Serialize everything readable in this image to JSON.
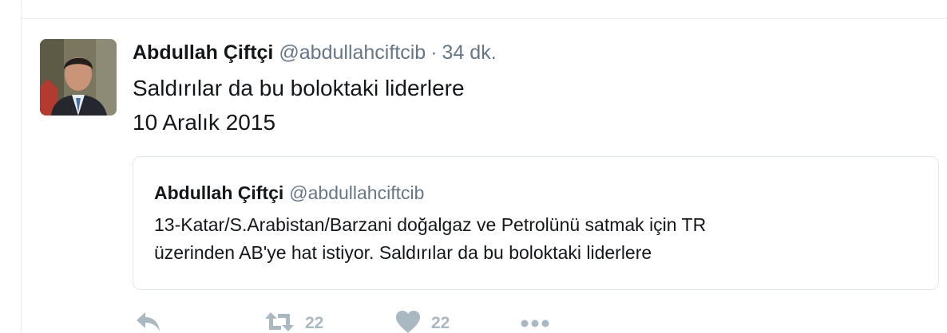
{
  "tweet": {
    "author_name": "Abdullah Çiftçi",
    "author_handle": "@abdullahciftcib",
    "separator": "·",
    "time": "34 dk.",
    "text_lines": [
      "Saldırılar da bu boloktaki liderlere",
      "10 Aralık 2015"
    ]
  },
  "quoted_tweet": {
    "author_name": "Abdullah Çiftçi",
    "author_handle": "@abdullahciftcib",
    "text_lines": [
      "13-Katar/S.Arabistan/Barzani doğalgaz ve Petrolünü satmak için TR",
      "üzerinden AB'ye hat istiyor. Saldırılar da bu boloktaki liderlere"
    ]
  },
  "actions": {
    "reply_icon": "reply-icon",
    "retweet_icon": "retweet-icon",
    "retweet_count": "22",
    "like_icon": "heart-icon",
    "like_count": "22",
    "more_icon": "more-dots-icon"
  },
  "colors": {
    "text_primary": "#14171a",
    "text_secondary": "#657786",
    "action_gray": "#aab8c2",
    "border": "#e1e8ed"
  }
}
